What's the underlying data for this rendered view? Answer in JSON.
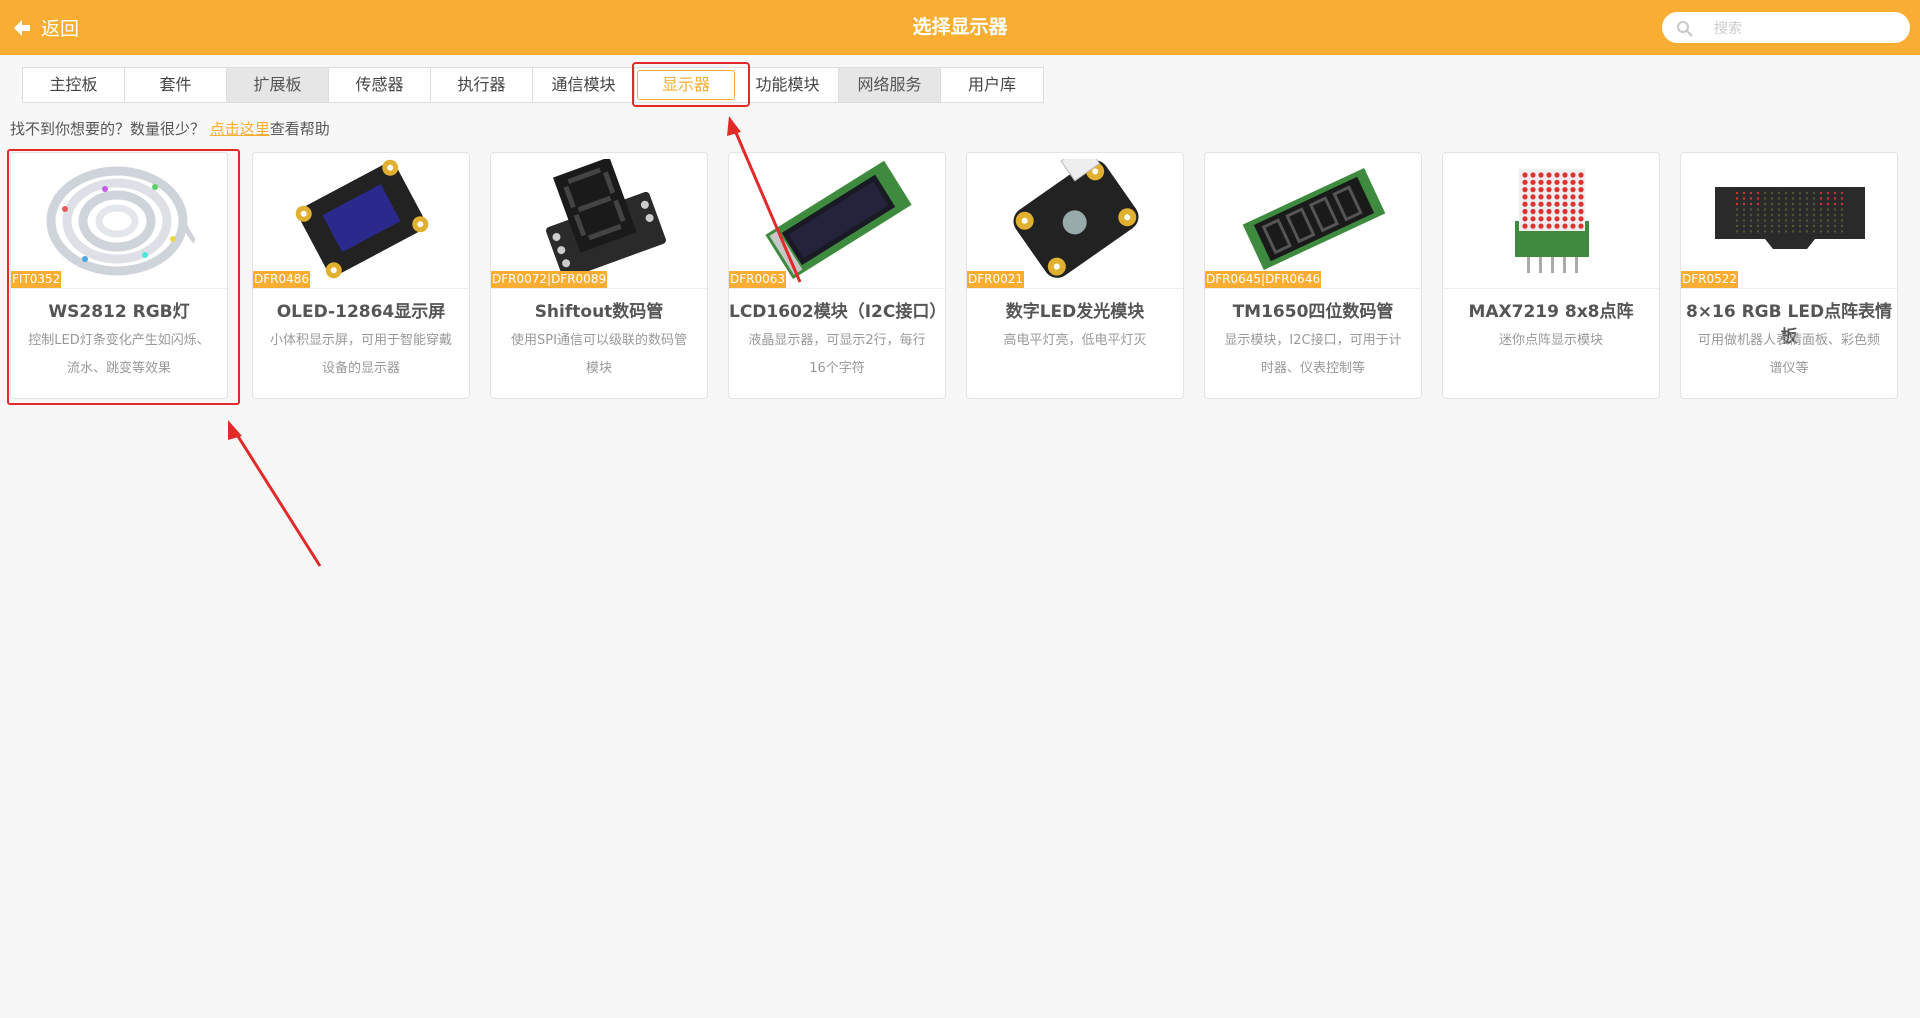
{
  "header": {
    "back_label": "返回",
    "title": "选择显示器",
    "search_placeholder": "搜索"
  },
  "tabs": [
    {
      "label": "主控板",
      "state": "normal"
    },
    {
      "label": "套件",
      "state": "normal"
    },
    {
      "label": "扩展板",
      "state": "gray"
    },
    {
      "label": "传感器",
      "state": "normal"
    },
    {
      "label": "执行器",
      "state": "normal"
    },
    {
      "label": "通信模块",
      "state": "normal"
    },
    {
      "label": "显示器",
      "state": "active"
    },
    {
      "label": "功能模块",
      "state": "normal"
    },
    {
      "label": "网络服务",
      "state": "gray"
    },
    {
      "label": "用户库",
      "state": "normal"
    }
  ],
  "help": {
    "prefix": "找不到你想要的？数量很少？ ",
    "link": "点击这里",
    "suffix": "查看帮助"
  },
  "cards": [
    {
      "sku": "FIT0352",
      "title": "WS2812 RGB灯",
      "desc": "控制LED灯条变化产生如闪烁、流水、跳变等效果",
      "icon": "led-strip-icon"
    },
    {
      "sku": "DFR0486",
      "title": "OLED-12864显示屏",
      "desc": "小体积显示屏，可用于智能穿戴设备的显示器",
      "icon": "oled-module-icon"
    },
    {
      "sku": "DFR0072|DFR0089",
      "title": "Shiftout数码管",
      "desc": "使用SPI通信可以级联的数码管模块",
      "icon": "seven-segment-icon"
    },
    {
      "sku": "DFR0063",
      "title": "LCD1602模块（I2C接口）",
      "desc": "液晶显示器，可显示2行，每行16个字符",
      "icon": "lcd1602-icon"
    },
    {
      "sku": "DFR0021",
      "title": "数字LED发光模块",
      "desc": "高电平灯亮，低电平灯灭",
      "icon": "led-module-icon"
    },
    {
      "sku": "DFR0645|DFR0646",
      "title": "TM1650四位数码管",
      "desc": "显示模块，I2C接口，可用于计时器、仪表控制等",
      "icon": "four-digit-display-icon"
    },
    {
      "sku": "",
      "title": "MAX7219 8x8点阵",
      "desc": "迷你点阵显示模块",
      "icon": "dot-matrix-icon"
    },
    {
      "sku": "DFR0522",
      "title": "8×16 RGB LED点阵表情板",
      "desc": "可用做机器人表情面板、彩色频谱仪等",
      "icon": "led-matrix-panel-icon"
    }
  ],
  "colors": {
    "accent": "#f9ae33",
    "annotation": "#e12a2a"
  }
}
